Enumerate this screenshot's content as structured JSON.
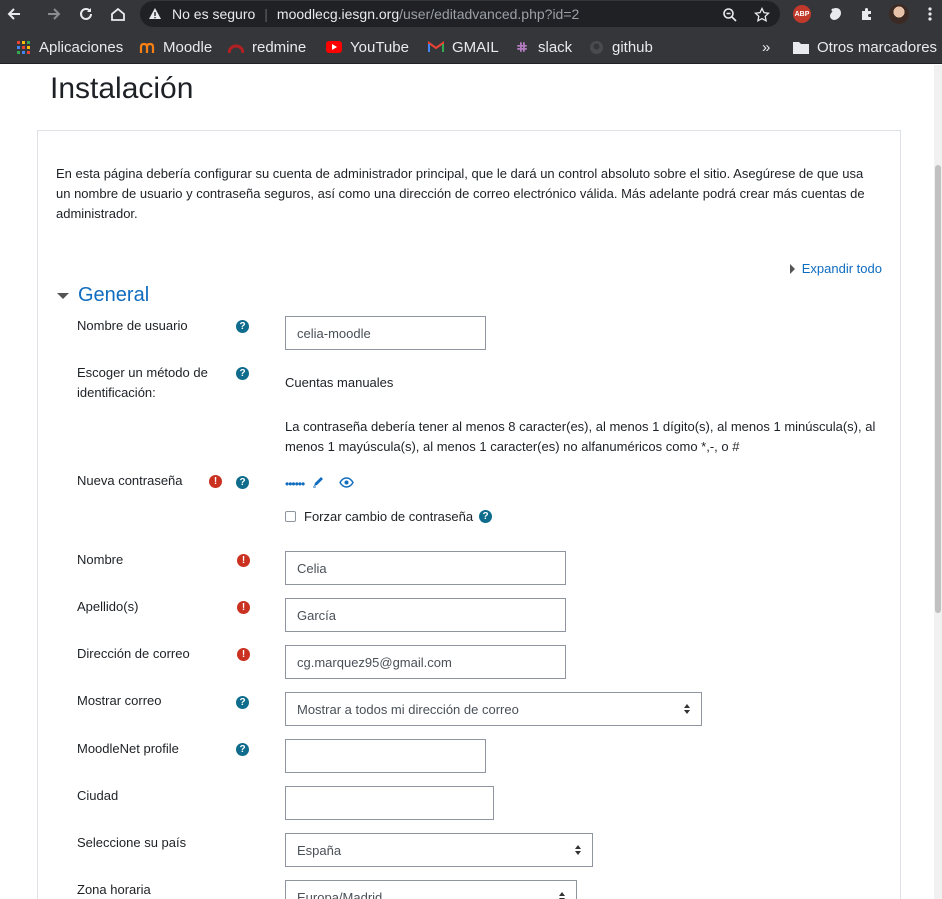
{
  "browser": {
    "insecure_label": "No es seguro",
    "url_host": "moodlecg.iesgn.org",
    "url_path": "/user/editadvanced.php?id=2",
    "bookmarks": [
      {
        "label": "Aplicaciones",
        "icon": "apps-grid-icon"
      },
      {
        "label": "Moodle",
        "icon": "moodle-icon"
      },
      {
        "label": "redmine",
        "icon": "redmine-icon"
      },
      {
        "label": "YouTube",
        "icon": "youtube-icon"
      },
      {
        "label": "GMAIL",
        "icon": "gmail-icon"
      },
      {
        "label": "slack",
        "icon": "slack-icon"
      },
      {
        "label": "github",
        "icon": "github-icon"
      }
    ],
    "overflow": "»",
    "other_bookmarks": "Otros marcadores"
  },
  "page": {
    "title": "Instalación",
    "intro": "En esta página debería configurar su cuenta de administrador principal, que le dará un control absoluto sobre el sitio. Asegúrese de que usa un nombre de usuario y contraseña seguros, así como una dirección de correo electrónico válida. Más adelante podrá crear más cuentas de administrador.",
    "expand_all": "Expandir todo",
    "section_general": "General"
  },
  "form": {
    "username": {
      "label": "Nombre de usuario",
      "value": "celia-moodle"
    },
    "auth": {
      "label": "Escoger un método de identificación:",
      "value": "Cuentas manuales"
    },
    "password_policy": "La contraseña debería tener al menos 8 caracter(es), al menos 1 dígito(s), al menos 1 minúscula(s), al menos 1 mayúscula(s), al menos 1 caracter(es) no alfanuméricos como *,-, o #",
    "new_password": {
      "label": "Nueva contraseña",
      "masked": "••••••"
    },
    "force_change": {
      "label": "Forzar cambio de contraseña",
      "checked": false
    },
    "firstname": {
      "label": "Nombre",
      "value": "Celia"
    },
    "lastname": {
      "label": "Apellido(s)",
      "value": "García"
    },
    "email": {
      "label": "Dirección de correo",
      "value": "cg.marquez95@gmail.com"
    },
    "maildisplay": {
      "label": "Mostrar correo",
      "value": "Mostrar a todos mi dirección de correo"
    },
    "moodlenet": {
      "label": "MoodleNet profile",
      "value": ""
    },
    "city": {
      "label": "Ciudad",
      "value": ""
    },
    "country": {
      "label": "Seleccione su país",
      "value": "España"
    },
    "timezone": {
      "label": "Zona horaria",
      "value": "Europa/Madrid"
    }
  },
  "colors": {
    "link": "#0f6cbf",
    "required": "#ca3120",
    "help": "#0f6c8c",
    "chrome": "#35363a"
  }
}
